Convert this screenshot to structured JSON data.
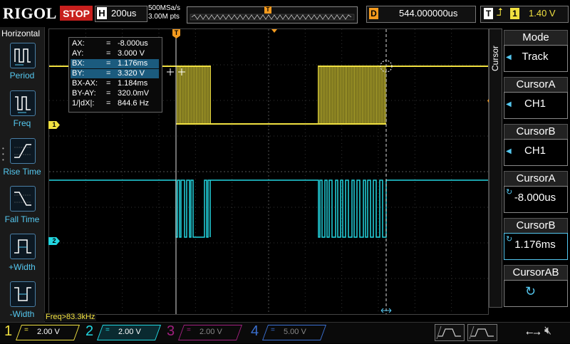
{
  "topbar": {
    "logo": "RIGOL",
    "run_state": "STOP",
    "h_letter": "H",
    "timebase": "200us",
    "sample_rate": "500MSa/s",
    "memory_depth": "3.00M pts",
    "trigger_marker": "T",
    "d_letter": "D",
    "delay": "544.000000us",
    "t_letter": "T",
    "trigger_source": "1",
    "trigger_level": "1.40 V"
  },
  "left_panel": {
    "title": "Horizontal",
    "items": [
      {
        "label": "Period",
        "icon": "period-icon"
      },
      {
        "label": "Freq",
        "icon": "freq-icon"
      },
      {
        "label": "Rise Time",
        "icon": "rise-time-icon"
      },
      {
        "label": "Fall Time",
        "icon": "fall-time-icon"
      },
      {
        "label": "+Width",
        "icon": "positive-width-icon"
      },
      {
        "label": "-Width",
        "icon": "negative-width-icon"
      }
    ]
  },
  "cursor_info": [
    {
      "key": "AX:",
      "eq": "=",
      "value": "-8.000us"
    },
    {
      "key": "AY:",
      "eq": "=",
      "value": "3.000 V"
    },
    {
      "key": "BX:",
      "eq": "=",
      "value": "1.176ms"
    },
    {
      "key": "BY:",
      "eq": "=",
      "value": "3.320 V"
    },
    {
      "key": "BX-AX:",
      "eq": "=",
      "value": "1.184ms"
    },
    {
      "key": "BY-AY:",
      "eq": "=",
      "value": "320.0mV"
    },
    {
      "key": "1/|dX|:",
      "eq": "=",
      "value": "844.6 Hz"
    }
  ],
  "freq_readout": "Freq>83.3kHz",
  "markers": {
    "ch1": "1",
    "ch2": "2",
    "trigger_top": "T",
    "trigger_right": "T"
  },
  "right_panel": {
    "tab_label": "Cursor",
    "menus": [
      {
        "title": "Mode",
        "value": "Track"
      },
      {
        "title": "CursorA",
        "value": "CH1"
      },
      {
        "title": "CursorB",
        "value": "CH1"
      },
      {
        "title": "CursorA",
        "value": "-8.000us"
      },
      {
        "title": "CursorB",
        "value": "1.176ms"
      },
      {
        "title": "CursorAB",
        "value": ""
      }
    ]
  },
  "channels": [
    {
      "num": "1",
      "coupling": "=",
      "scale": "2.00 V",
      "color": "#f0e040"
    },
    {
      "num": "2",
      "coupling": "=",
      "scale": "2.00 V",
      "color": "#22d6e0"
    },
    {
      "num": "3",
      "coupling": "=",
      "scale": "2.00 V",
      "color": "#a0207e"
    },
    {
      "num": "4",
      "coupling": "=",
      "scale": "5.00 V",
      "color": "#3a6fd0"
    }
  ],
  "colors": {
    "ch1": "#f0e040",
    "ch2": "#22d6e0",
    "accent": "#f39a1e",
    "menu_blue": "#55c8f0"
  }
}
